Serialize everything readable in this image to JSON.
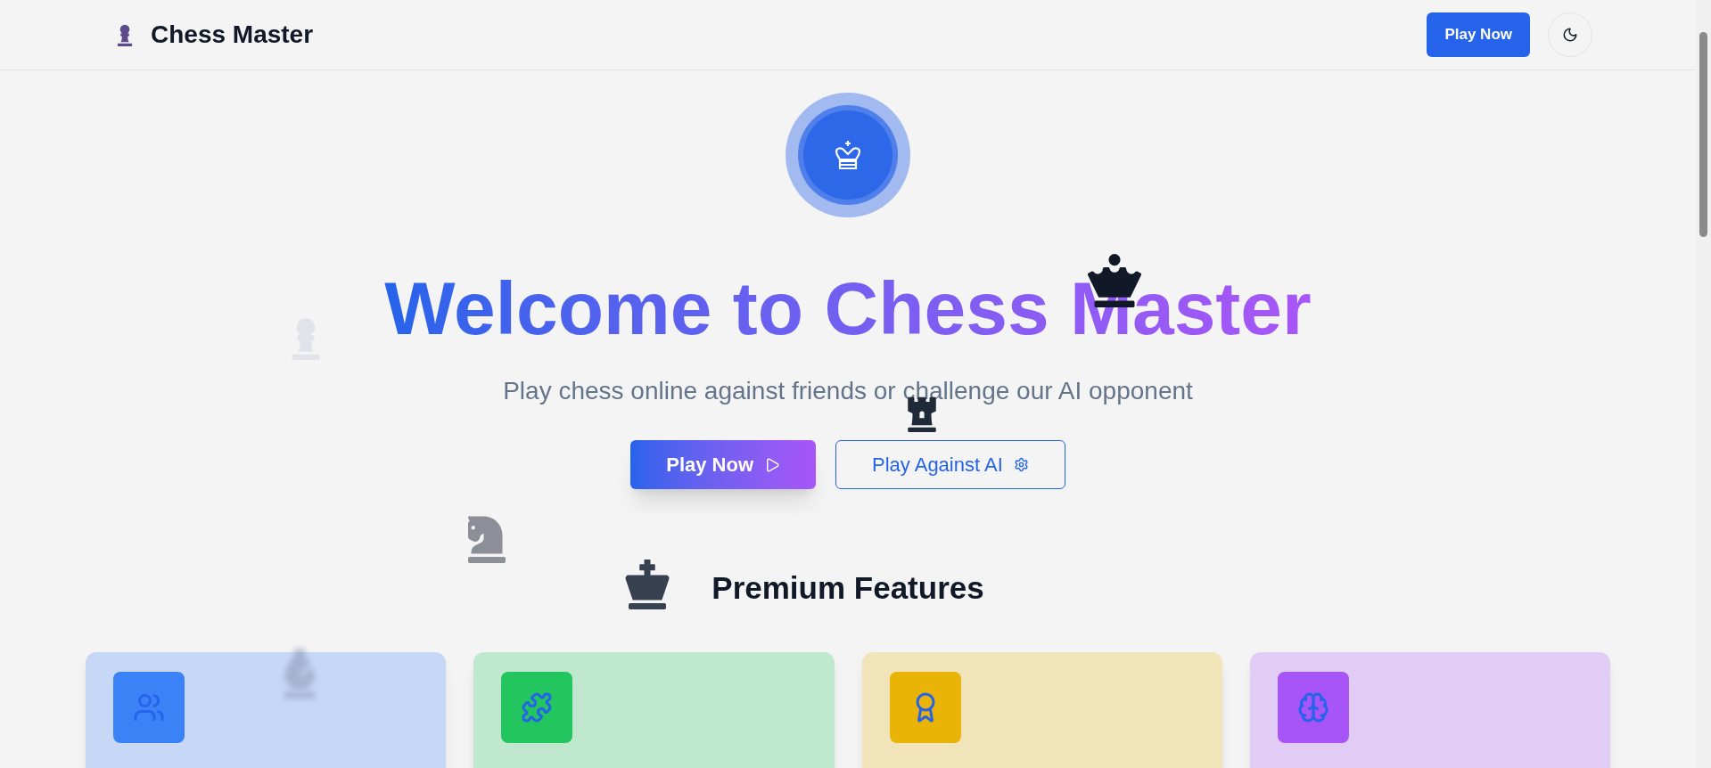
{
  "header": {
    "logo": "Chess Master",
    "play_button": "Play Now"
  },
  "hero": {
    "title": "Welcome to Chess Master",
    "subtitle": "Play chess online against friends or challenge our AI opponent",
    "buttons": [
      {
        "label": "Play Now",
        "kind": "primary"
      },
      {
        "label": "Play Against AI",
        "kind": "outline"
      }
    ]
  },
  "features": {
    "heading": "Premium Features",
    "cards": [
      {
        "kind": "users",
        "color": "#3b82f6"
      },
      {
        "kind": "puzzle",
        "color": "#22c55e"
      },
      {
        "kind": "award",
        "color": "#eab308"
      },
      {
        "kind": "brain",
        "color": "#a855f7"
      }
    ]
  }
}
